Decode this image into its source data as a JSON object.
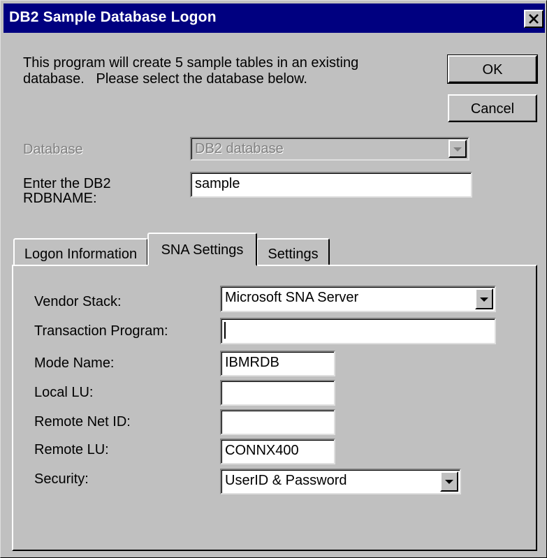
{
  "window": {
    "title": "DB2 Sample Database Logon",
    "close_glyph": "×"
  },
  "intro": {
    "line1": "This program will create 5 sample tables in an existing",
    "line2": "database.   Please select the database below."
  },
  "buttons": {
    "ok": "OK",
    "cancel": "Cancel"
  },
  "database": {
    "label": "Database",
    "value": "DB2 database",
    "disabled": true
  },
  "rdbname": {
    "label_line1": "Enter the DB2",
    "label_line2": "RDBNAME:",
    "value": "sample"
  },
  "tabs": [
    {
      "label": "Logon Information",
      "active": false
    },
    {
      "label": "SNA Settings",
      "active": true
    },
    {
      "label": "Settings",
      "active": false
    }
  ],
  "sna": {
    "vendor_stack": {
      "label": "Vendor Stack:",
      "value": "Microsoft SNA Server"
    },
    "transaction_program": {
      "label": "Transaction Program:",
      "value": ""
    },
    "mode_name": {
      "label": "Mode Name:",
      "value": "IBMRDB"
    },
    "local_lu": {
      "label": "Local LU:",
      "value": ""
    },
    "remote_net_id": {
      "label": "Remote Net ID:",
      "value": ""
    },
    "remote_lu": {
      "label": "Remote LU:",
      "value": "CONNX400"
    },
    "security": {
      "label": "Security:",
      "value": "UserID & Password"
    }
  },
  "icons": {
    "close": "close-icon",
    "dropdown": "chevron-down-icon"
  }
}
